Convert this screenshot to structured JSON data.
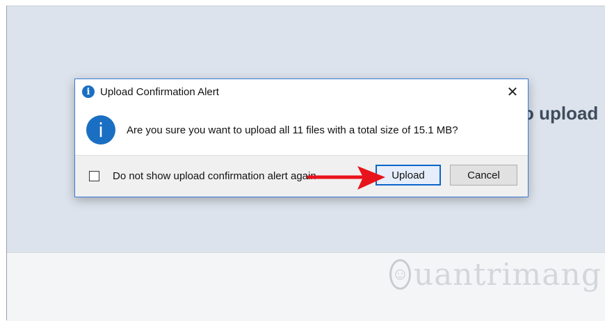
{
  "background": {
    "partial_heading": "o upload",
    "watermark": "uantrimang"
  },
  "dialog": {
    "title": "Upload Confirmation Alert",
    "close_glyph": "✕",
    "info_glyph": "i",
    "message": "Are you sure you want to upload all 11 files with a total size of 15.1 MB?",
    "checkbox_label": "Do not show upload confirmation alert again",
    "checkbox_checked": false,
    "upload_label": "Upload",
    "cancel_label": "Cancel"
  },
  "colors": {
    "accent": "#1a6fc2",
    "arrow": "#e8141b",
    "focus_border": "#0a64c8"
  },
  "icons": {
    "title": "info-icon",
    "message": "info-icon",
    "close": "close-icon",
    "annotation": "red-arrow"
  }
}
